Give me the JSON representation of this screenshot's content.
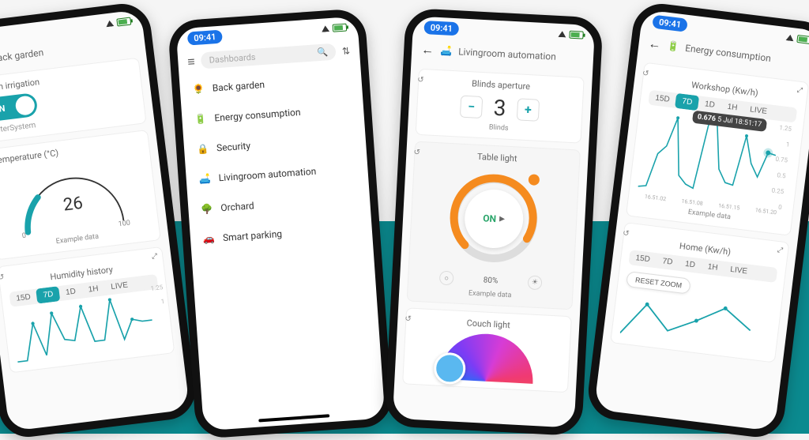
{
  "colors": {
    "accent": "#19a2ab",
    "orange": "#f58b1f",
    "green": "#2aa56a"
  },
  "status": {
    "time": "09:41",
    "wifi": true,
    "battery": true
  },
  "phone1": {
    "screen_title": "Back garden",
    "screen_icon": "🌻",
    "irrigation": {
      "title": "Main irrigation",
      "state_label": "ON",
      "on": true,
      "sub": "WaterSystem"
    },
    "gauge": {
      "title": "Temperature (°C)",
      "value": 26,
      "min": 0,
      "max": 100,
      "caption": "Example data"
    },
    "humidity": {
      "title": "Humidity history",
      "ranges": [
        "15D",
        "7D",
        "1D",
        "1H",
        "LIVE"
      ],
      "active_range": "7D",
      "ymax": 1.25
    }
  },
  "phone2": {
    "search_placeholder": "Dashboards",
    "items": [
      {
        "icon": "🌻",
        "label": "Back garden"
      },
      {
        "icon": "🔋",
        "label": "Energy consumption"
      },
      {
        "icon": "🔒",
        "label": "Security"
      },
      {
        "icon": "🛋️",
        "label": "Livingroom automation"
      },
      {
        "icon": "🌳",
        "label": "Orchard"
      },
      {
        "icon": "🚗",
        "label": "Smart parking"
      }
    ]
  },
  "phone3": {
    "screen_title": "Livingroom automation",
    "screen_icon": "🛋️",
    "blinds": {
      "title": "Blinds aperture",
      "value": 3,
      "sub": "Blinds"
    },
    "table_light": {
      "title": "Table light",
      "state_label": "ON",
      "percent": "80%",
      "caption": "Example data"
    },
    "couch_light": {
      "title": "Couch light",
      "color": "#5ab8f0"
    }
  },
  "phone4": {
    "screen_title": "Energy consumption",
    "screen_icon": "🔋",
    "workshop": {
      "title": "Workshop (Kw/h)",
      "ranges": [
        "15D",
        "7D",
        "1D",
        "1H",
        "LIVE"
      ],
      "active_range": "7D",
      "tooltip": {
        "value": "0.676",
        "ts": "5 Jul 18:51:17"
      },
      "yticks": [
        "1.25",
        "1",
        "0.75",
        "0.5",
        "0.25",
        "0"
      ],
      "xticks": [
        "16.51.02",
        "16.51.08",
        "16.51.15",
        "16.51.20"
      ],
      "caption": "Example data"
    },
    "home": {
      "title": "Home (Kw/h)",
      "ranges": [
        "15D",
        "7D",
        "1D",
        "1H",
        "LIVE"
      ],
      "reset_label": "RESET ZOOM"
    }
  },
  "chart_data": [
    {
      "name": "Humidity history",
      "type": "line",
      "title": "Humidity history",
      "xlabel": "",
      "ylabel": "",
      "ylim": [
        0,
        1.25
      ],
      "x": [
        0,
        1,
        2,
        3,
        4,
        5,
        6,
        7,
        8,
        9,
        10,
        11,
        12,
        13,
        14
      ],
      "values": [
        0.05,
        0.05,
        0.8,
        0.1,
        1.0,
        0.35,
        0.3,
        1.1,
        0.25,
        0.25,
        1.2,
        0.2,
        0.6,
        0.55,
        0.55
      ]
    },
    {
      "name": "Temperature gauge",
      "type": "gauge",
      "title": "Temperature (°C)",
      "value": 26,
      "min": 0,
      "max": 100
    },
    {
      "name": "Workshop (Kw/h)",
      "type": "line",
      "title": "Workshop (Kw/h)",
      "ylabel": "Kw/h",
      "ylim": [
        0,
        1.25
      ],
      "x_labels": [
        "16.51.02",
        "16.51.08",
        "16.51.15",
        "16.51.20"
      ],
      "x": [
        0,
        1,
        2,
        3,
        4,
        5,
        6,
        7,
        8,
        9,
        10,
        11,
        12,
        13,
        14,
        15,
        16,
        17
      ],
      "values": [
        0.1,
        0.12,
        0.52,
        0.65,
        1.15,
        0.3,
        0.2,
        0.15,
        1.05,
        1.2,
        0.4,
        0.25,
        0.22,
        0.95,
        0.55,
        0.4,
        0.7,
        0.68
      ],
      "highlight": {
        "index": 15,
        "value": 0.676,
        "label": "5 Jul 18:51:17"
      }
    },
    {
      "name": "Home (Kw/h)",
      "type": "line",
      "title": "Home (Kw/h)",
      "ylim": [
        0,
        1.25
      ],
      "x": [
        0,
        1,
        2,
        3,
        4,
        5
      ],
      "values": [
        0.1,
        0.8,
        0.3,
        0.6,
        0.9,
        0.55
      ]
    }
  ]
}
